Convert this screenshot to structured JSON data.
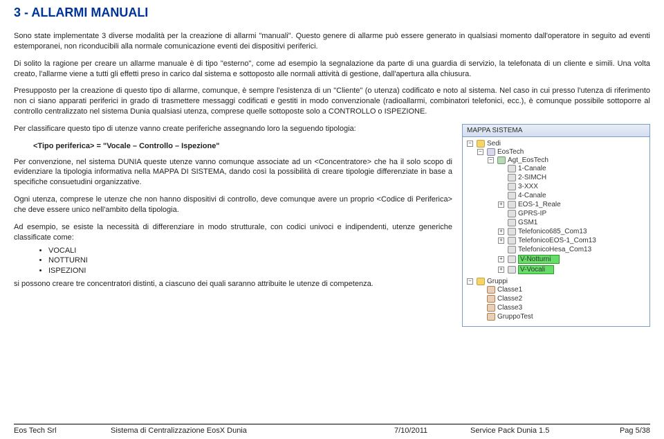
{
  "heading": "3 - ALLARMI MANUALI",
  "p1": "Sono state implementate 3 diverse modalità per la creazione di allarmi \"manuali\". Questo genere di allarme può essere generato in qualsiasi momento dall'operatore in seguito ad eventi estemporanei, non riconducibili alla normale comunicazione eventi dei dispositivi periferici.",
  "p2": "Di solito la ragione per creare un allarme manuale è di tipo \"esterno\", come ad esempio la segnalazione da parte di una guardia di servizio, la telefonata di un cliente e simili. Una volta creato, l'allarme viene a tutti gli effetti preso in carico dal sistema e sottoposto alle normali attività di gestione, dall'apertura alla chiusura.",
  "p3": "Presupposto per la creazione di questo tipo di allarme, comunque, è sempre l'esistenza di un \"Cliente\" (o utenza) codificato e noto al sistema.\nNel caso in cui presso l'utenza di riferimento non ci siano apparati periferici in grado di trasmettere messaggi codificati e gestiti in modo convenzionale (radioallarmi, combinatori telefonici, ecc.), è comunque possibile sottoporre al controllo centralizzato nel sistema Dunia qualsiasi utenza, comprese quelle sottoposte solo a CONTROLLO o ISPEZIONE.",
  "left": {
    "l1": "Per classificare questo tipo di utenze vanno create periferiche assegnando loro la seguendo tipologia:",
    "formula": "<Tipo periferica> = \"Vocale – Controllo – Ispezione\"",
    "l2": "Per convenzione, nel sistema DUNIA queste utenze vanno comunque associate ad un <Concentratore> che ha il solo scopo di evidenziare la tipologia informativa nella MAPPA DI SISTEMA, dando così la possibilità di creare tipologie differenziate in base a specifiche consuetudini organizzative.",
    "l3": "Ogni utenza, comprese le utenze che non hanno dispositivi di controllo, deve comunque avere un proprio <Codice di Periferica> che deve essere unico nell'ambito della tipologia.",
    "l4": "Ad esempio, se esiste la necessità di differenziare in modo strutturale, con codici univoci e indipendenti, utenze generiche classificate come:",
    "items": [
      "VOCALI",
      "NOTTURNI",
      "ISPEZIONI"
    ],
    "l5": "si possono creare tre concentratori distinti, a ciascuno dei quali saranno attribuite le utenze di competenza."
  },
  "panel": {
    "title": "MAPPA SISTEMA",
    "sedi": "Sedi",
    "eostech": "EosTech",
    "agt": "Agt_EosTech",
    "n1": "1-Canale",
    "n2": "2-SIMCH",
    "n3": "3-XXX",
    "n4": "4-Canale",
    "eos1": "EOS-1_Reale",
    "gprs": "GPRS-IP",
    "gsm1": "GSM1",
    "t685": "Telefonico685_Com13",
    "teos1": "TelefonicoEOS-1_Com13",
    "thesa": "TelefonicoHesa_Com13",
    "vnott": "V-Notturni",
    "vvocali": "V-Vocali",
    "gruppi": "Gruppi",
    "c1": "Classe1",
    "c2": "Classe2",
    "c3": "Classe3",
    "gt": "GruppoTest"
  },
  "footer": {
    "company": "Eos Tech Srl",
    "title": "Sistema di Centralizzazione EosX Dunia",
    "date": "7/10/2011",
    "doc": "Service Pack Dunia 1.5",
    "page": "Pag 5/38"
  }
}
